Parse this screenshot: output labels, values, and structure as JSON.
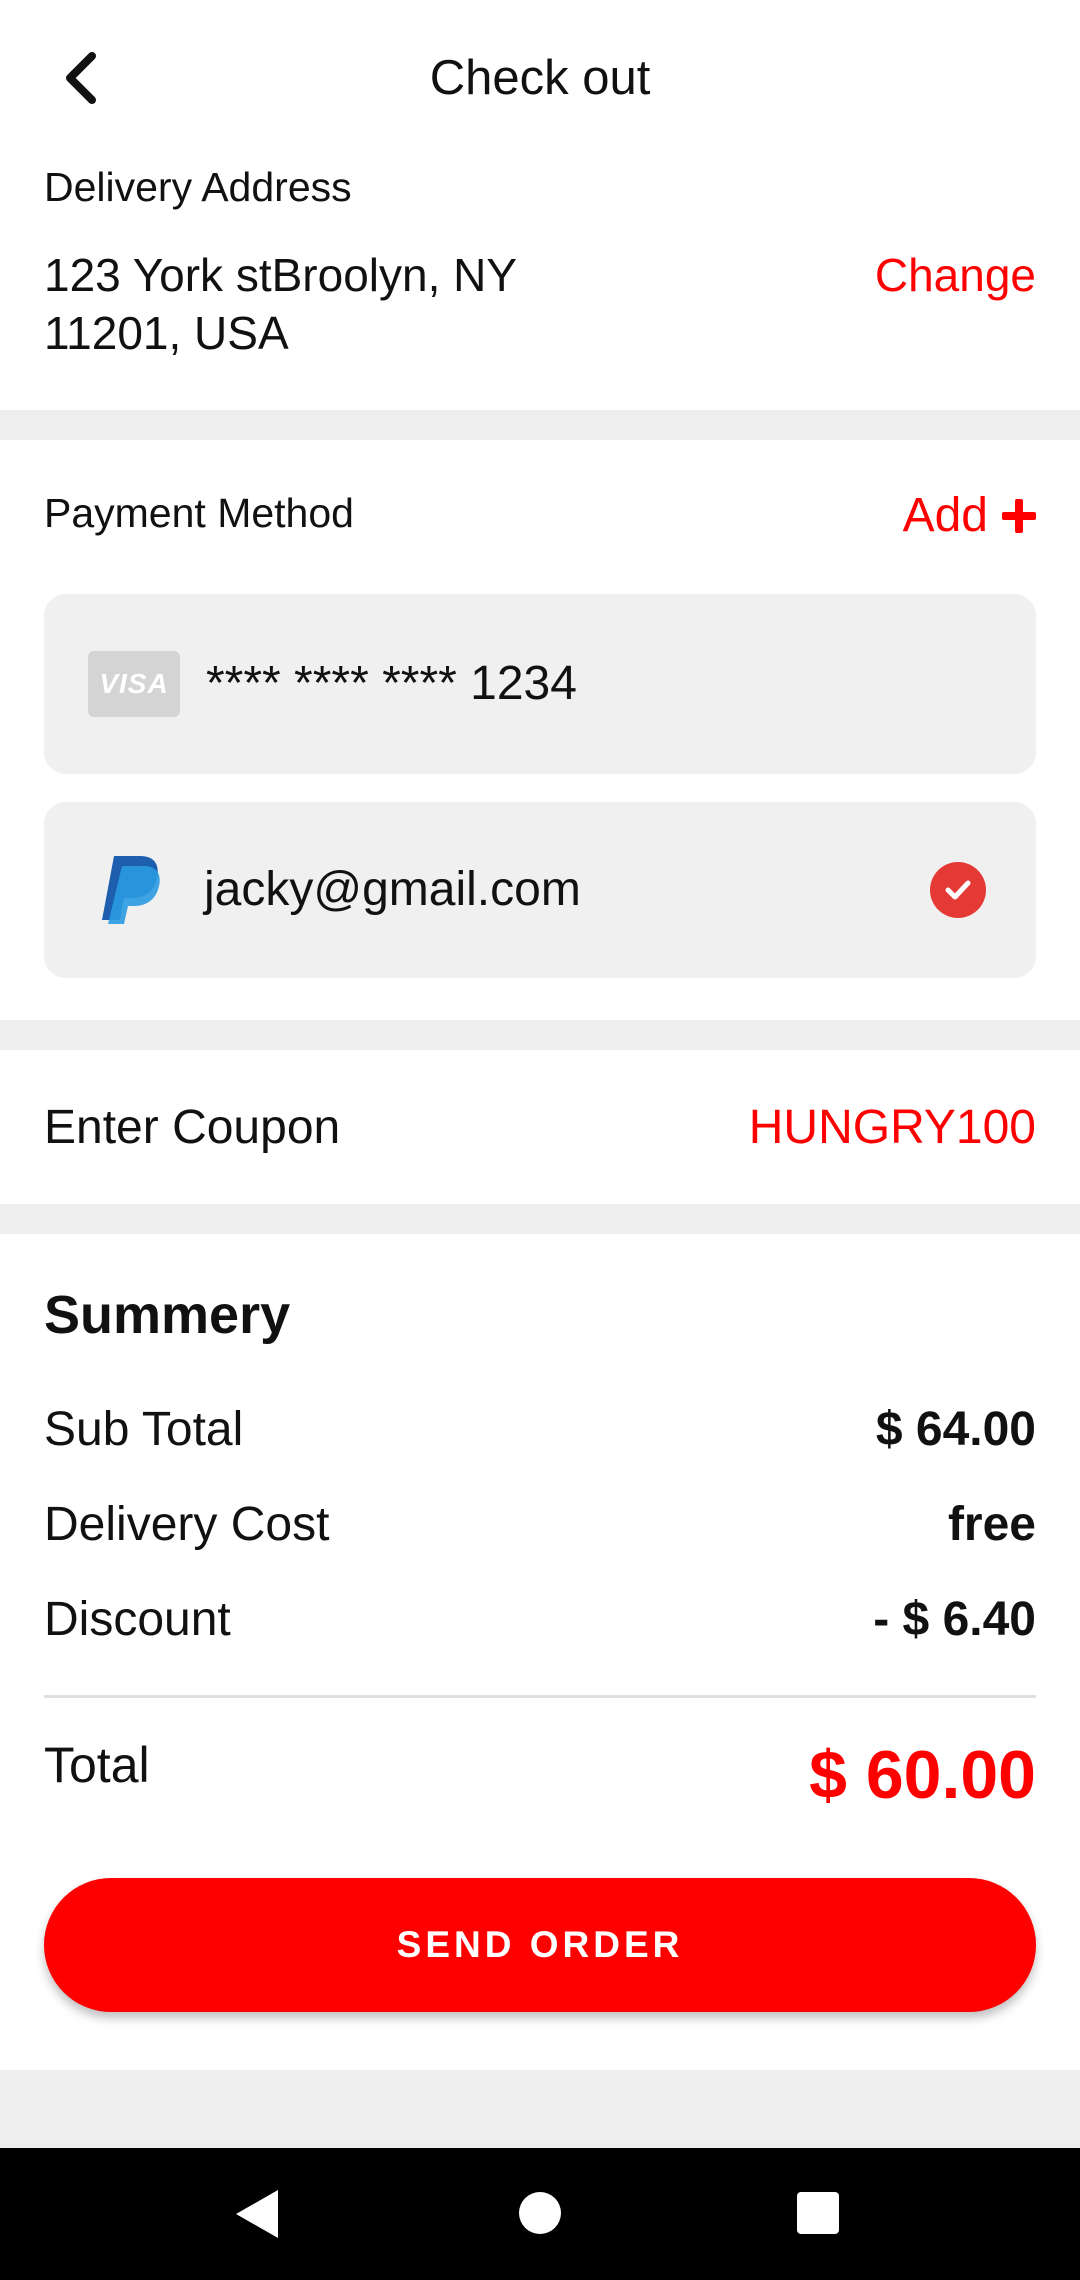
{
  "header": {
    "title": "Check out"
  },
  "delivery": {
    "label": "Delivery Address",
    "address": "123 York stBroolyn, NY 11201, USA",
    "change_label": "Change"
  },
  "payment": {
    "label": "Payment Method",
    "add_label": "Add",
    "methods": [
      {
        "type": "visa",
        "logo_text": "VISA",
        "text": "**** **** **** 1234",
        "selected": false
      },
      {
        "type": "paypal",
        "text": "jacky@gmail.com",
        "selected": true
      }
    ]
  },
  "coupon": {
    "label": "Enter Coupon",
    "code": "HUNGRY100"
  },
  "summary": {
    "title": "Summery",
    "rows": [
      {
        "label": "Sub Total",
        "value": "$ 64.00"
      },
      {
        "label": "Delivery Cost",
        "value": "free"
      },
      {
        "label": "Discount",
        "value": "- $ 6.40"
      }
    ],
    "total_label": "Total",
    "total_value": "$ 60.00"
  },
  "action": {
    "send_label": "SEND ORDER"
  },
  "colors": {
    "accent": "#ff0000",
    "check": "#e53935",
    "card_bg": "#f0f0f0",
    "divider": "#eeeeee"
  }
}
